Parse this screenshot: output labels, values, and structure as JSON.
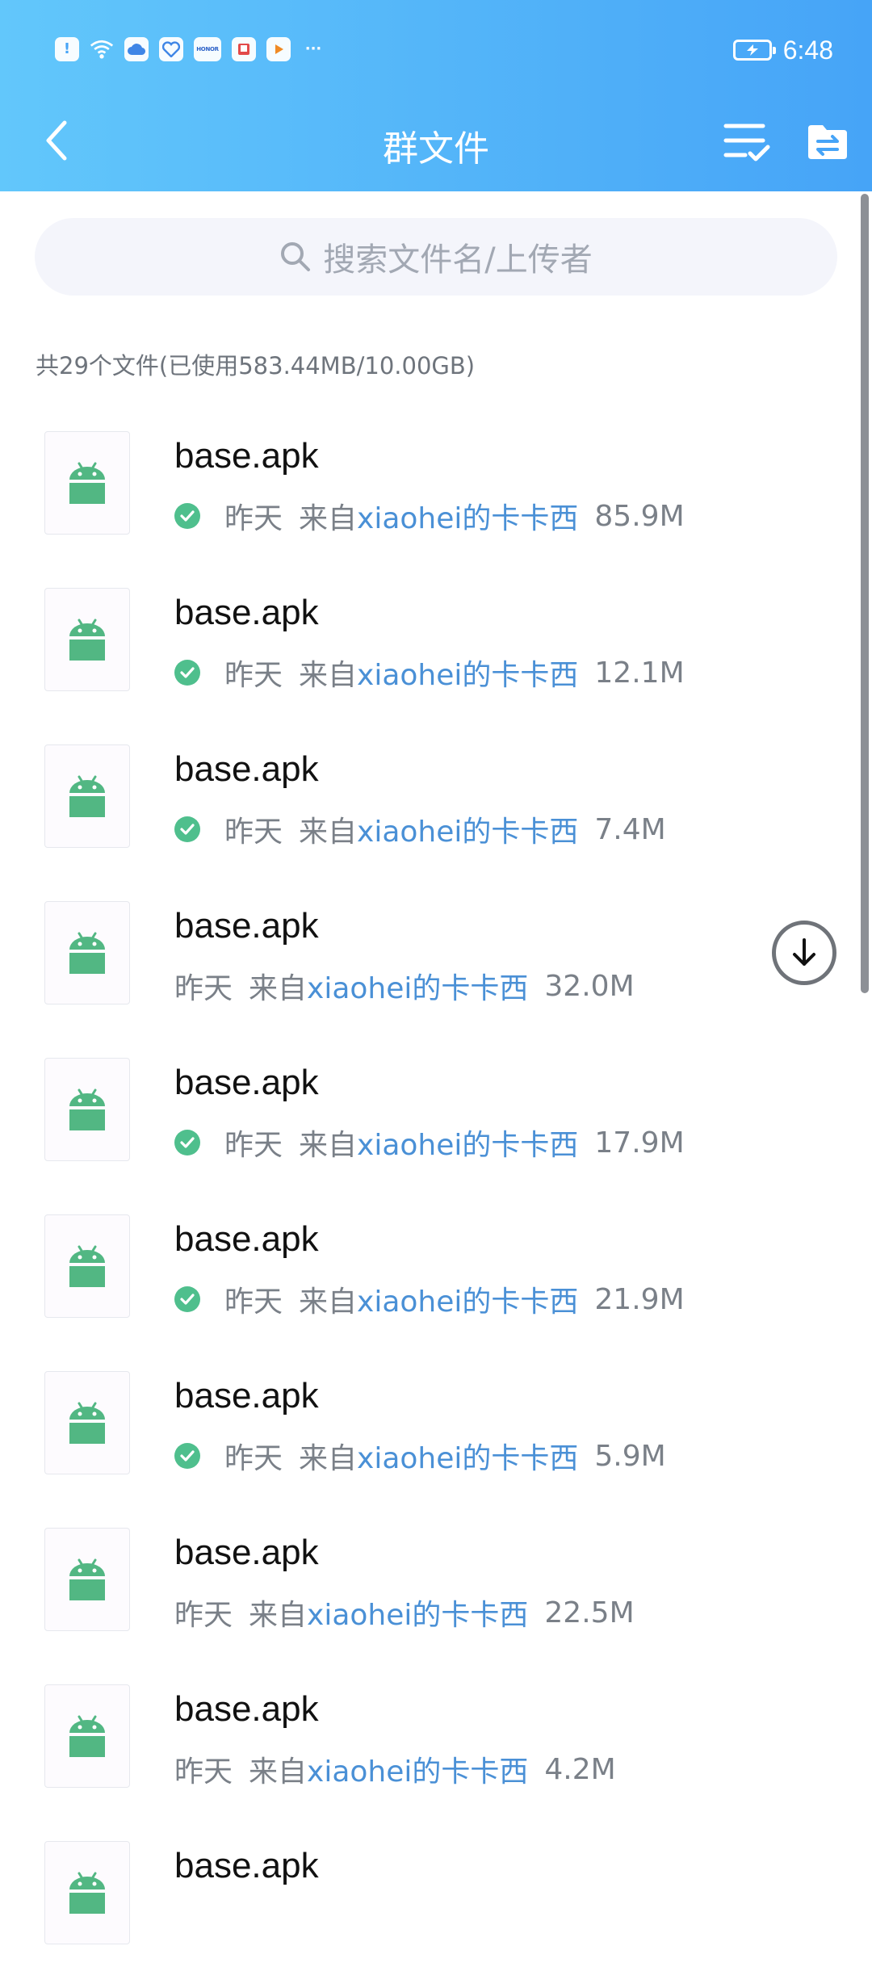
{
  "status_bar": {
    "time": "6:48",
    "icons": [
      "alert-icon",
      "wifi-icon",
      "cloud-icon",
      "health-icon",
      "honor-icon",
      "book-icon",
      "video-icon",
      "more-icon"
    ],
    "honor_label": "HONOR",
    "more": "···"
  },
  "toolbar": {
    "title": "群文件",
    "back": "back-icon",
    "actions": [
      "checklist-icon",
      "folder-transfer-icon"
    ]
  },
  "search": {
    "placeholder": "搜索文件名/上传者"
  },
  "summary": "共29个文件(已使用583.44MB/10.00GB)",
  "colors": {
    "header_start": "#62c7fb",
    "header_end": "#46a4f7",
    "link": "#4a90d6",
    "check": "#4fbf8d",
    "android": "#52b783"
  },
  "files": [
    {
      "name": "base.apk",
      "downloaded": true,
      "date": "昨天",
      "from": "来自",
      "user": "xiaohei的卡卡西",
      "size": "85.9M"
    },
    {
      "name": "base.apk",
      "downloaded": true,
      "date": "昨天",
      "from": "来自",
      "user": "xiaohei的卡卡西",
      "size": "12.1M"
    },
    {
      "name": "base.apk",
      "downloaded": true,
      "date": "昨天",
      "from": "来自",
      "user": "xiaohei的卡卡西",
      "size": "7.4M"
    },
    {
      "name": "base.apk",
      "downloaded": false,
      "date": "昨天",
      "from": "来自",
      "user": "xiaohei的卡卡西",
      "size": "32.0M"
    },
    {
      "name": "base.apk",
      "downloaded": true,
      "date": "昨天",
      "from": "来自",
      "user": "xiaohei的卡卡西",
      "size": "17.9M"
    },
    {
      "name": "base.apk",
      "downloaded": true,
      "date": "昨天",
      "from": "来自",
      "user": "xiaohei的卡卡西",
      "size": "21.9M"
    },
    {
      "name": "base.apk",
      "downloaded": true,
      "date": "昨天",
      "from": "来自",
      "user": "xiaohei的卡卡西",
      "size": "5.9M"
    },
    {
      "name": "base.apk",
      "downloaded": false,
      "date": "昨天",
      "from": "来自",
      "user": "xiaohei的卡卡西",
      "size": "22.5M"
    },
    {
      "name": "base.apk",
      "downloaded": false,
      "date": "昨天",
      "from": "来自",
      "user": "xiaohei的卡卡西",
      "size": "4.2M"
    },
    {
      "name": "base.apk"
    }
  ]
}
